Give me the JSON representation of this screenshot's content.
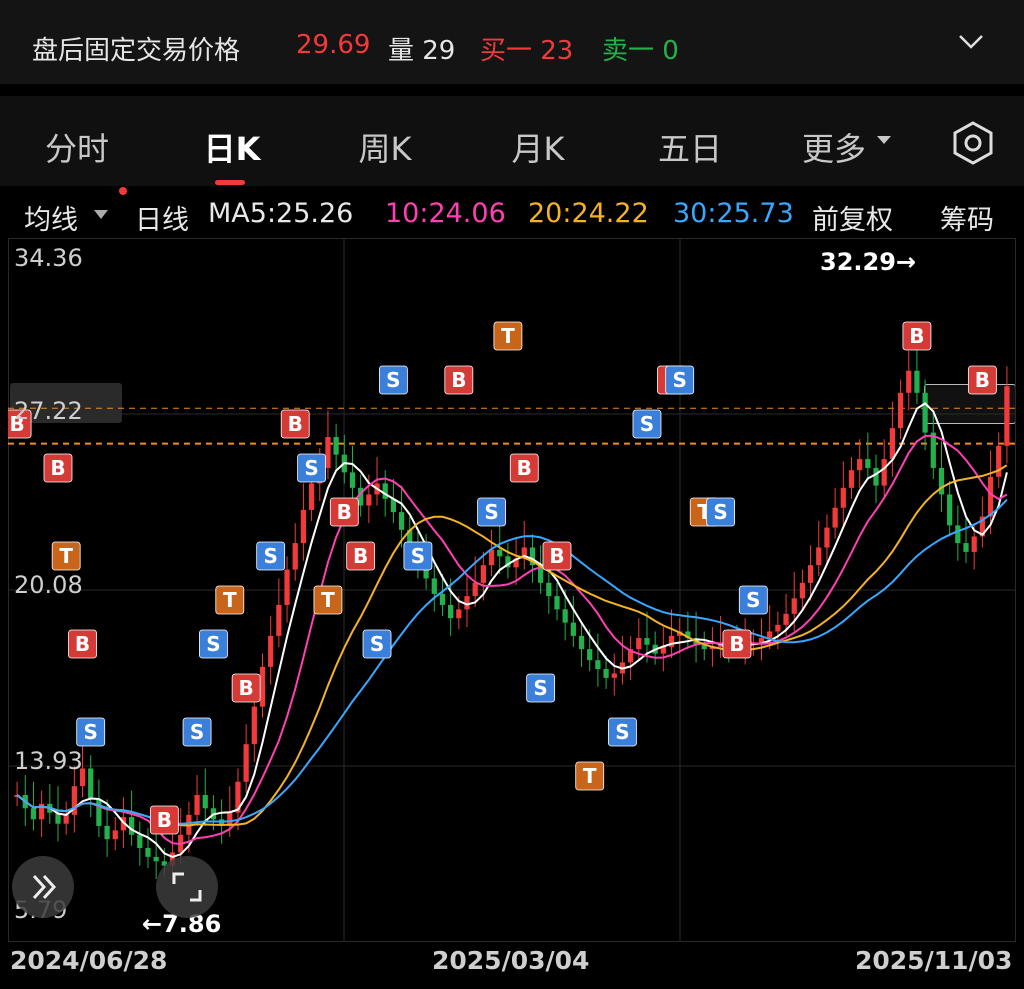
{
  "header": {
    "after_hours_label": "盘后固定交易价格",
    "price": "29.69",
    "volume_label": "量 29",
    "bid_label": "买一 23",
    "ask_label": "卖一 0"
  },
  "tabs": [
    "分时",
    "日K",
    "周K",
    "月K",
    "五日",
    "更多"
  ],
  "active_tab": "日K",
  "indicator_bar": {
    "avg_label": "均线",
    "period_label": "日线",
    "ma5": "MA5:25.26",
    "ma10": "10:24.06",
    "ma20": "20:24.22",
    "ma30": "30:25.73",
    "adjust_label": "前复权",
    "chips_label": "筹码"
  },
  "colors": {
    "up": "#f23a3a",
    "down": "#22b14c",
    "ma5": "#ffffff",
    "ma10": "#ff3fb4",
    "ma20": "#f5b324",
    "ma30": "#38a8ff",
    "marker_B": "#d63a36",
    "marker_S": "#3a7fd9",
    "marker_T": "#c8651a",
    "marker_gray": "#9a9a9a"
  },
  "chart_data": {
    "type": "line",
    "y_ticks": [
      "34.36",
      "27.22",
      "20.08",
      "13.93",
      "5.79"
    ],
    "x_ticks": [
      "2024/06/28",
      "2025/03/04",
      "2025/11/03"
    ],
    "high_marker": "32.29→",
    "low_marker": "←7.86",
    "reference_lines": [
      28.7,
      27.1
    ],
    "close_series": [
      11.2,
      10.6,
      10.1,
      10.8,
      10.4,
      9.9,
      10.3,
      11.6,
      12.4,
      11.0,
      9.8,
      9.2,
      9.6,
      10.2,
      9.4,
      8.8,
      8.4,
      8.2,
      8.0,
      8.6,
      9.4,
      10.3,
      11.2,
      10.6,
      10.1,
      9.8,
      10.4,
      11.8,
      13.5,
      15.2,
      17.0,
      18.4,
      19.8,
      21.4,
      22.6,
      24.1,
      25.3,
      26.0,
      27.4,
      26.6,
      25.8,
      25.1,
      24.3,
      24.8,
      25.3,
      24.6,
      24.0,
      23.2,
      22.4,
      21.8,
      21.0,
      20.3,
      19.8,
      19.2,
      19.6,
      20.2,
      20.8,
      21.6,
      22.3,
      22.0,
      21.5,
      21.9,
      22.4,
      21.6,
      20.8,
      20.2,
      19.6,
      19.0,
      18.4,
      17.8,
      17.3,
      16.9,
      16.5,
      16.7,
      17.2,
      17.8,
      18.3,
      18.0,
      17.6,
      17.9,
      18.4,
      18.6,
      18.3,
      18.0,
      17.8,
      17.9,
      18.1,
      18.0,
      17.9,
      18.0,
      18.1,
      18.3,
      18.6,
      18.9,
      19.4,
      20.1,
      20.8,
      21.6,
      22.4,
      23.3,
      24.2,
      25.1,
      25.9,
      26.4,
      26.0,
      25.2,
      26.4,
      27.8,
      29.4,
      30.4,
      29.4,
      27.6,
      26.0,
      24.8,
      23.4,
      22.6,
      22.2,
      22.9,
      23.8,
      25.6,
      27.0,
      29.7
    ],
    "ma5_value": 25.26,
    "ma10_value": 24.06,
    "ma20_value": 24.22,
    "ma30_value": 25.73
  },
  "nav": {
    "expand_icon": "double-chevron-right-icon",
    "fullscreen_icon": "fullscreen-icon"
  }
}
